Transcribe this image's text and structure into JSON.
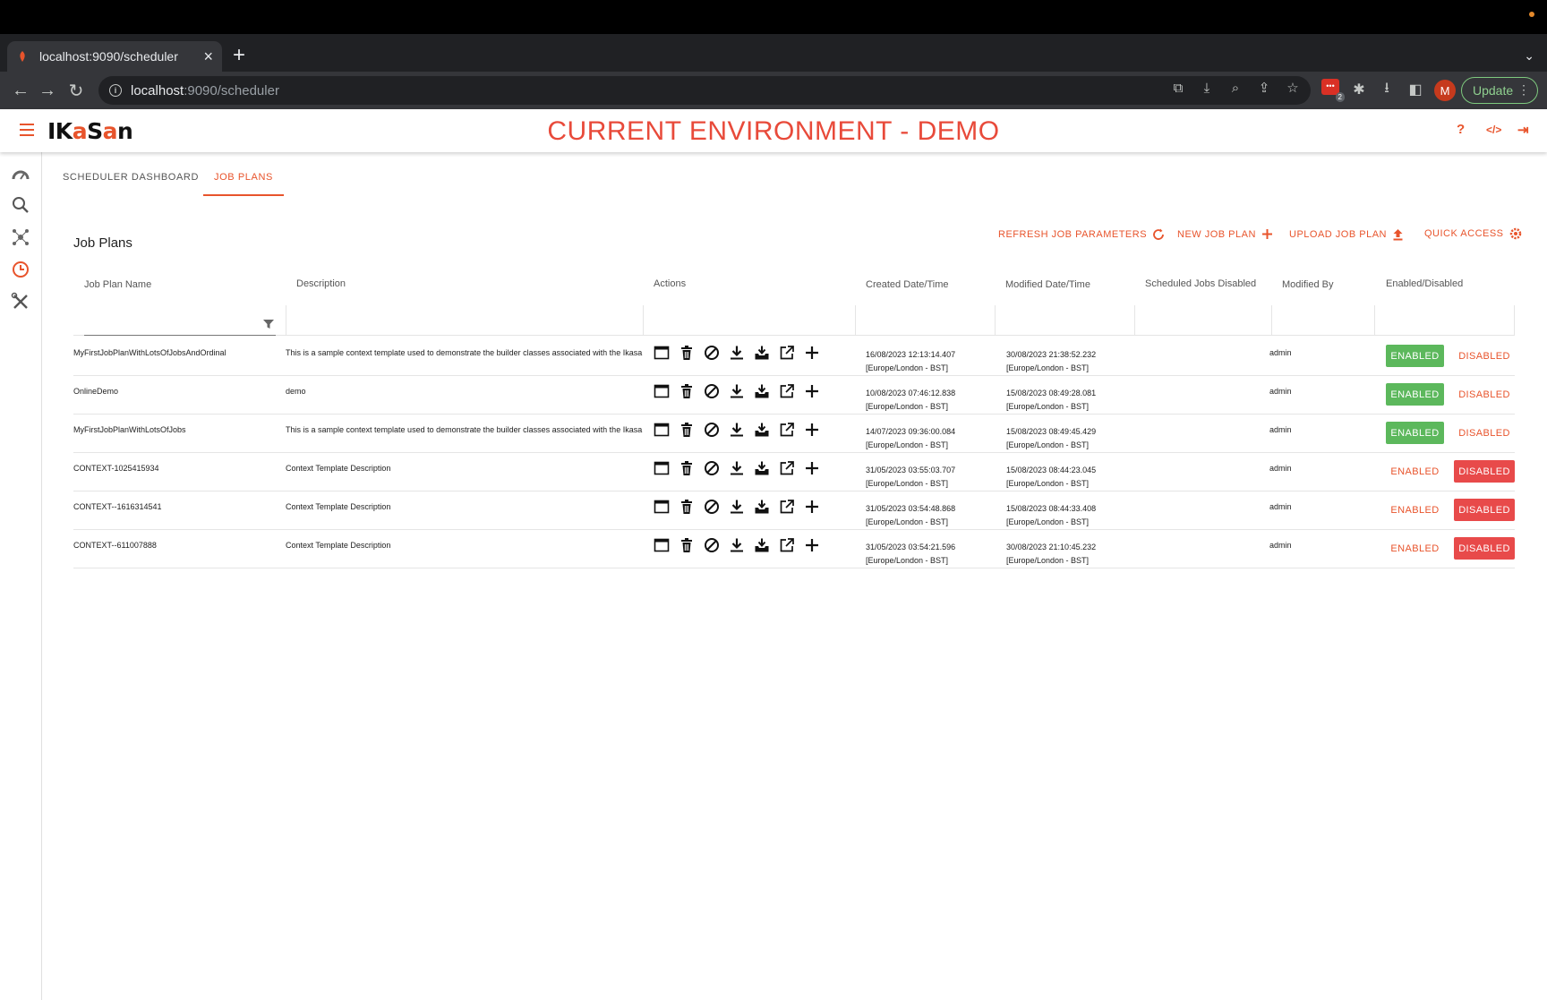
{
  "browser": {
    "tab_title": "localhost:9090/scheduler",
    "new_tab": "+",
    "url_host": "localhost",
    "url_path": ":9090/scheduler",
    "profile_initial": "M",
    "update_label": "Update",
    "extension_badge_count": "2"
  },
  "app": {
    "logo_prefix": "IK",
    "logo_accent": "a",
    "logo_mid": "S",
    "logo_accent2": "a",
    "logo_suffix": "n",
    "env_title": "CURRENT ENVIRONMENT - DEMO",
    "accent_color": "#e8542c"
  },
  "tabs": [
    {
      "label": "SCHEDULER DASHBOARD",
      "active": false
    },
    {
      "label": "JOB PLANS",
      "active": true
    }
  ],
  "section_title": "Job Plans",
  "actions": {
    "refresh": "REFRESH JOB PARAMETERS",
    "new_plan": "NEW JOB PLAN",
    "upload": "UPLOAD JOB PLAN",
    "quick_access": "QUICK ACCESS"
  },
  "columns": {
    "name": "Job Plan Name",
    "description": "Description",
    "actions": "Actions",
    "created": "Created Date/Time",
    "modified": "Modified Date/Time",
    "scheduled_disabled": "Scheduled Jobs Disabled",
    "modified_by": "Modified By",
    "enabled_disabled": "Enabled/Disabled"
  },
  "rows": [
    {
      "name": "MyFirstJobPlanWithLotsOfJobsAndOrdinal",
      "description": "This is a sample context template used to demonstrate the builder classes associated with the Ikasa",
      "created": "16/08/2023 12:13:14.407",
      "created_tz": "[Europe/London - BST]",
      "modified": "30/08/2023 21:38:52.232",
      "modified_tz": "[Europe/London - BST]",
      "modified_by": "admin",
      "enabled": "ENABLED",
      "disabled": "DISABLED",
      "state": "enabled"
    },
    {
      "name": "OnlineDemo",
      "description": "demo",
      "created": "10/08/2023 07:46:12.838",
      "created_tz": "[Europe/London - BST]",
      "modified": "15/08/2023 08:49:28.081",
      "modified_tz": "[Europe/London - BST]",
      "modified_by": "admin",
      "enabled": "ENABLED",
      "disabled": "DISABLED",
      "state": "enabled"
    },
    {
      "name": "MyFirstJobPlanWithLotsOfJobs",
      "description": "This is a sample context template used to demonstrate the builder classes associated with the Ikasa",
      "created": "14/07/2023 09:36:00.084",
      "created_tz": "[Europe/London - BST]",
      "modified": "15/08/2023 08:49:45.429",
      "modified_tz": "[Europe/London - BST]",
      "modified_by": "admin",
      "enabled": "ENABLED",
      "disabled": "DISABLED",
      "state": "enabled"
    },
    {
      "name": "CONTEXT-1025415934",
      "description": "Context Template Description",
      "created": "31/05/2023 03:55:03.707",
      "created_tz": "[Europe/London - BST]",
      "modified": "15/08/2023 08:44:23.045",
      "modified_tz": "[Europe/London - BST]",
      "modified_by": "admin",
      "enabled": "ENABLED",
      "disabled": "DISABLED",
      "state": "disabled"
    },
    {
      "name": "CONTEXT--1616314541",
      "description": "Context Template Description",
      "created": "31/05/2023 03:54:48.868",
      "created_tz": "[Europe/London - BST]",
      "modified": "15/08/2023 08:44:33.408",
      "modified_tz": "[Europe/London - BST]",
      "modified_by": "admin",
      "enabled": "ENABLED",
      "disabled": "DISABLED",
      "state": "disabled"
    },
    {
      "name": "CONTEXT--611007888",
      "description": "Context Template Description",
      "created": "31/05/2023 03:54:21.596",
      "created_tz": "[Europe/London - BST]",
      "modified": "30/08/2023 21:10:45.232",
      "modified_tz": "[Europe/London - BST]",
      "modified_by": "admin",
      "enabled": "ENABLED",
      "disabled": "DISABLED",
      "state": "disabled"
    }
  ],
  "row_action_icons": [
    "window-icon",
    "delete-icon",
    "disable-icon",
    "download-icon",
    "download-tray-icon",
    "open-external-icon",
    "add-icon"
  ],
  "colors": {
    "enabled_green": "#5cb85c",
    "disabled_red": "#e84a4a"
  }
}
